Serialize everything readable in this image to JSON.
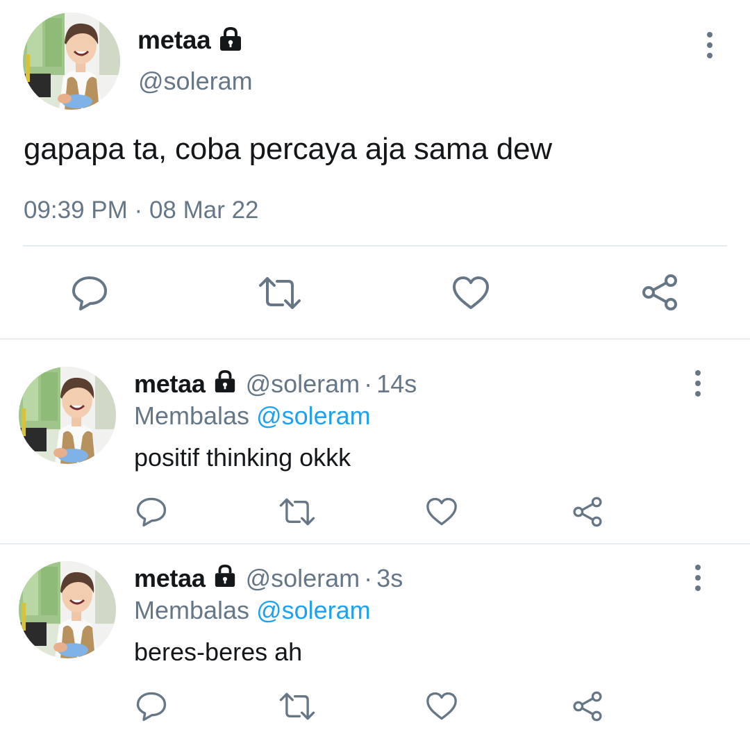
{
  "tweet": {
    "display_name": "metaa",
    "handle": "@soleram",
    "text": "gapapa ta, coba percaya aja sama dew",
    "time": "09:39 PM",
    "separator": "·",
    "date": "08 Mar 22",
    "icons": {
      "lock": "lock-icon",
      "more": "more-vertical-icon",
      "reply": "comment-icon",
      "retweet": "retweet-icon",
      "like": "heart-icon",
      "share": "share-icon"
    }
  },
  "replies": [
    {
      "display_name": "metaa",
      "handle": "@soleram",
      "separator": "·",
      "time": "14s",
      "replying_label": "Membalas",
      "replying_to": "@soleram",
      "text": "positif thinking okkk"
    },
    {
      "display_name": "metaa",
      "handle": "@soleram",
      "separator": "·",
      "time": "3s",
      "replying_label": "Membalas",
      "replying_to": "@soleram",
      "text": "beres-beres ah"
    }
  ],
  "colors": {
    "text_primary": "#14171a",
    "text_secondary": "#657786",
    "accent_link": "#1da1f2",
    "divider": "#e6ecf0"
  }
}
